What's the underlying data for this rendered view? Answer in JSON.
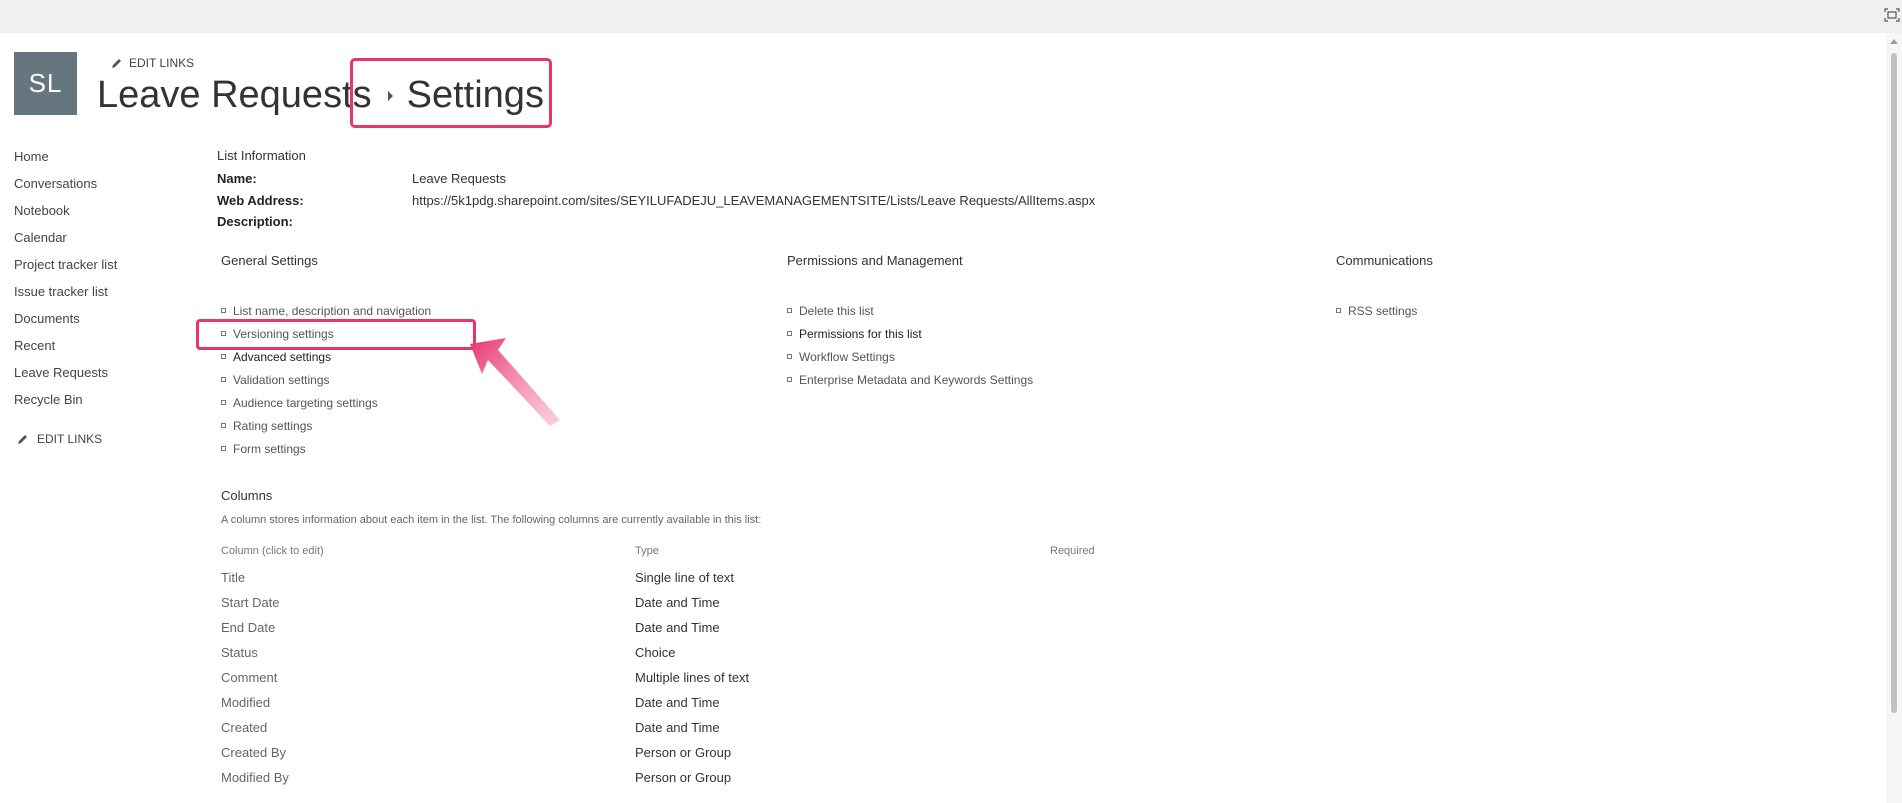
{
  "header": {
    "logo_initials": "SL",
    "edit_links": "EDIT LINKS",
    "breadcrumb": [
      "Leave Requests",
      "Settings"
    ]
  },
  "nav": {
    "items": [
      "Home",
      "Conversations",
      "Notebook",
      "Calendar",
      "Project tracker list",
      "Issue tracker list",
      "Documents",
      "Recent",
      "Leave Requests",
      "Recycle Bin"
    ],
    "edit_links": "EDIT LINKS"
  },
  "list_info": {
    "heading": "List Information",
    "name_label": "Name:",
    "name_value": "Leave Requests",
    "web_label": "Web Address:",
    "web_value": "https://5k1pdg.sharepoint.com/sites/SEYILUFADEJU_LEAVEMANAGEMENTSITE/Lists/Leave Requests/AllItems.aspx",
    "desc_label": "Description:"
  },
  "general": {
    "heading": "General Settings",
    "links": [
      "List name, description and navigation",
      "Versioning settings",
      "Advanced settings",
      "Validation settings",
      "Audience targeting settings",
      "Rating settings",
      "Form settings"
    ]
  },
  "permissions": {
    "heading": "Permissions and Management",
    "links": [
      "Delete this list",
      "Permissions for this list",
      "Workflow Settings",
      "Enterprise Metadata and Keywords Settings"
    ]
  },
  "communications": {
    "heading": "Communications",
    "links": [
      "RSS settings"
    ]
  },
  "columns": {
    "heading": "Columns",
    "description": "A column stores information about each item in the list. The following columns are currently available in this list:",
    "headers": [
      "Column (click to edit)",
      "Type",
      "Required"
    ],
    "rows": [
      {
        "name": "Title",
        "type": "Single line of text"
      },
      {
        "name": "Start Date",
        "type": "Date and Time"
      },
      {
        "name": "End Date",
        "type": "Date and Time"
      },
      {
        "name": "Status",
        "type": "Choice"
      },
      {
        "name": "Comment",
        "type": "Multiple lines of text"
      },
      {
        "name": "Modified",
        "type": "Date and Time"
      },
      {
        "name": "Created",
        "type": "Date and Time"
      },
      {
        "name": "Created By",
        "type": "Person or Group"
      },
      {
        "name": "Modified By",
        "type": "Person or Group"
      }
    ]
  },
  "colors": {
    "highlight": "#e8356b",
    "logo_bg": "#66767e"
  }
}
